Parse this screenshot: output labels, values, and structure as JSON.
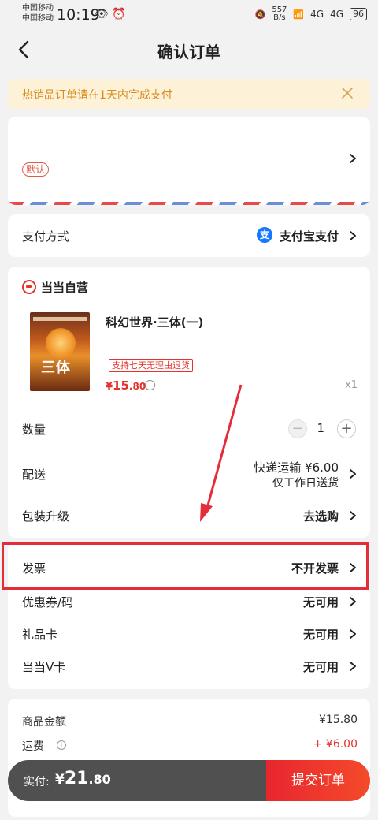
{
  "status_bar": {
    "carrier1": "中国移动",
    "carrier2": "中国移动",
    "time": "10:19",
    "speed": "557",
    "speed_unit": "B/s",
    "net1": "4G",
    "net2": "4G",
    "battery": "96"
  },
  "header": {
    "title": "确认订单"
  },
  "notice": {
    "text": "热销品订单请在1天内完成支付"
  },
  "address": {
    "default_badge": "默认"
  },
  "payment": {
    "label": "支付方式",
    "icon_text": "支",
    "value": "支付宝支付"
  },
  "store": {
    "name": "当当自营"
  },
  "product": {
    "title": "科幻世界·三体(一)",
    "cover_text": "三体",
    "return_tag": "支持七天无理由退货",
    "price_symbol": "¥",
    "price_int": "15",
    "price_dec": ".80",
    "quantity_suffix": "x1"
  },
  "rows": {
    "quantity": {
      "label": "数量",
      "value": "1"
    },
    "delivery": {
      "label": "配送",
      "value": "快递运输 ¥6.00",
      "sub": "仅工作日送货"
    },
    "packaging": {
      "label": "包装升级",
      "value": "去选购"
    },
    "invoice": {
      "label": "发票",
      "value": "不开发票"
    },
    "coupon": {
      "label": "优惠券/码",
      "value": "无可用"
    },
    "gift_card": {
      "label": "礼品卡",
      "value": "无可用"
    },
    "v_card": {
      "label": "当当V卡",
      "value": "无可用"
    }
  },
  "summary": {
    "goods_label": "商品金额",
    "goods_value": "¥15.80",
    "shipping_label": "运费",
    "shipping_value": "+ ¥6.00"
  },
  "pay_bar": {
    "label": "实付:",
    "amount_symbol": "¥",
    "amount_int": "21",
    "amount_dec": ".80",
    "submit_label": "提交订单"
  },
  "colors": {
    "accent": "#e5322d",
    "notice_bg": "#fdf2d8",
    "notice_text": "#d88a1a",
    "alipay": "#1677ff"
  }
}
